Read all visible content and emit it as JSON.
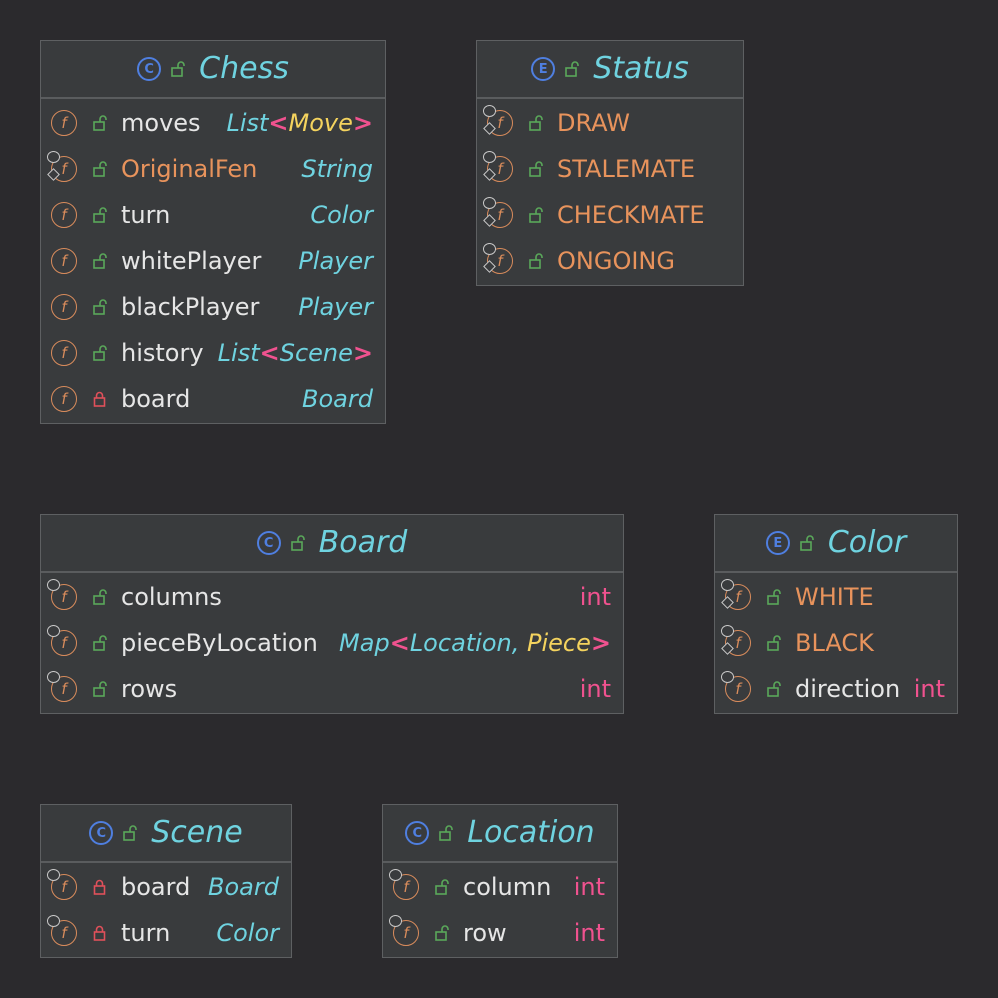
{
  "colors": {
    "background": "#2b2a2d",
    "box": "#393b3d",
    "type": "#6fd3e0",
    "field": "#e6e6e6",
    "constant": "#e8935c",
    "primitive": "#f0528f",
    "generic_bracket": "#f0528f",
    "highlight_type": "#f4d35e",
    "public_lock": "#5aa85a",
    "private_lock": "#e0505a",
    "class_icon": "#4f7fe0"
  },
  "icons": {
    "class": "class-circle-icon",
    "enum": "enum-circle-icon",
    "field": "field-circle-icon",
    "public": "unlocked-icon",
    "private": "locked-icon"
  },
  "chess": {
    "kind": "C",
    "title": "Chess",
    "fields": [
      {
        "name": "moves",
        "type_base": "List",
        "type_arg": "Move"
      },
      {
        "name": "OriginalFen",
        "type": "String"
      },
      {
        "name": "turn",
        "type": "Color"
      },
      {
        "name": "whitePlayer",
        "type": "Player"
      },
      {
        "name": "blackPlayer",
        "type": "Player"
      },
      {
        "name": "history",
        "type_base": "List",
        "type_arg": "Scene"
      },
      {
        "name": "board",
        "type": "Board"
      }
    ]
  },
  "status": {
    "kind": "E",
    "title": "Status",
    "constants": [
      "DRAW",
      "STALEMATE",
      "CHECKMATE",
      "ONGOING"
    ]
  },
  "board": {
    "kind": "C",
    "title": "Board",
    "fields": [
      {
        "name": "columns",
        "type": "int"
      },
      {
        "name": "pieceByLocation",
        "type_base": "Map",
        "type_arg1": "Location",
        "type_arg2": "Piece"
      },
      {
        "name": "rows",
        "type": "int"
      }
    ]
  },
  "color": {
    "kind": "E",
    "title": "Color",
    "constants": [
      "WHITE",
      "BLACK"
    ],
    "fields": [
      {
        "name": "direction",
        "type": "int"
      }
    ]
  },
  "scene": {
    "kind": "C",
    "title": "Scene",
    "fields": [
      {
        "name": "board",
        "type": "Board"
      },
      {
        "name": "turn",
        "type": "Color"
      }
    ]
  },
  "location": {
    "kind": "C",
    "title": "Location",
    "fields": [
      {
        "name": "column",
        "type": "int"
      },
      {
        "name": "row",
        "type": "int"
      }
    ]
  }
}
